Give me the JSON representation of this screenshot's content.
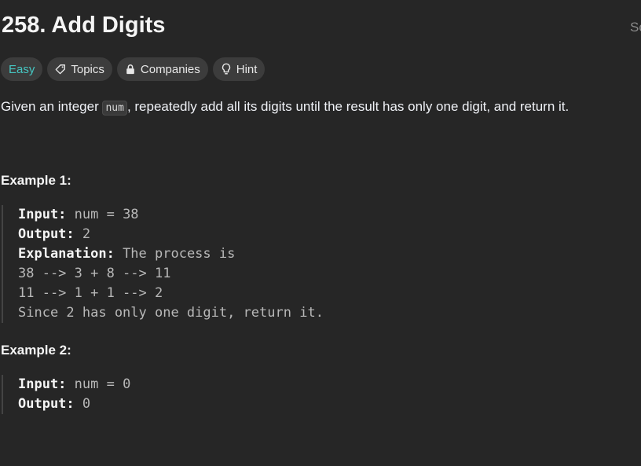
{
  "problem": {
    "title": "258. Add Digits",
    "side_text_cut": "So"
  },
  "tags": {
    "difficulty": "Easy",
    "topics": "Topics",
    "companies": "Companies",
    "hint": "Hint"
  },
  "description": {
    "before": "Given an integer ",
    "code": "num",
    "after": ", repeatedly add all its digits until the result has only one digit, and return it."
  },
  "examples": [
    {
      "heading": "Example 1:",
      "input_label": "Input:",
      "input_value": " num = 38",
      "output_label": "Output:",
      "output_value": " 2",
      "explanation_label": "Explanation:",
      "explanation_value": " The process is",
      "lines": [
        "38 --> 3 + 8 --> 11",
        "11 --> 1 + 1 --> 2",
        "Since 2 has only one digit, return it."
      ]
    },
    {
      "heading": "Example 2:",
      "input_label": "Input:",
      "input_value": " num = 0",
      "output_label": "Output:",
      "output_value": " 0"
    }
  ],
  "colors": {
    "background": "#262626",
    "easy": "#46c6c2",
    "chip": "#3c3c3c"
  },
  "icons": {
    "topics": "tag-icon",
    "companies": "lock-icon",
    "hint": "lightbulb-icon"
  }
}
